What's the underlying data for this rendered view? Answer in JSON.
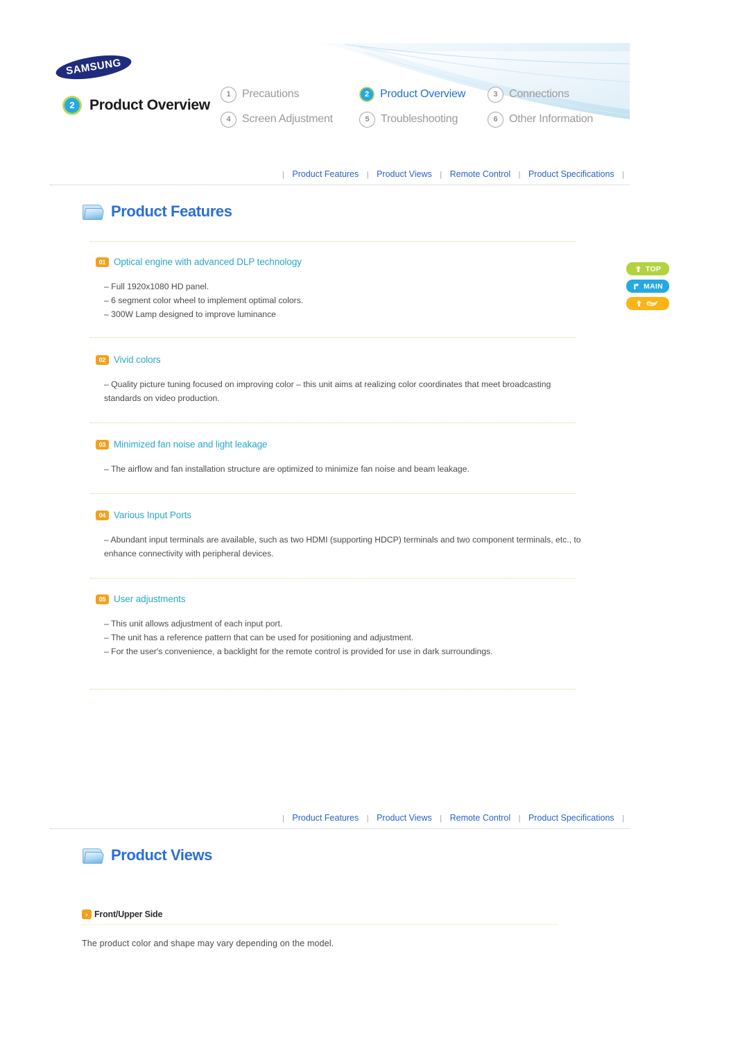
{
  "brand": {
    "logo_text": "SAMSUNG"
  },
  "header": {
    "current_chapter_number": "2",
    "current_chapter_title": "Product Overview",
    "chapters": [
      {
        "num": "1",
        "label": "Precautions",
        "active": false
      },
      {
        "num": "2",
        "label": "Product Overview",
        "active": true
      },
      {
        "num": "3",
        "label": "Connections",
        "active": false
      },
      {
        "num": "4",
        "label": "Screen Adjustment",
        "active": false
      },
      {
        "num": "5",
        "label": "Troubleshooting",
        "active": false
      },
      {
        "num": "6",
        "label": "Other Information",
        "active": false
      }
    ]
  },
  "subnav": {
    "separator": "|",
    "items": [
      "Product Features",
      "Product Views",
      "Remote Control",
      "Product Specifications"
    ]
  },
  "sections": {
    "product_features_title": "Product Features",
    "product_views_title": "Product Views"
  },
  "features": [
    {
      "num": "01",
      "heading": "Optical engine with advanced DLP technology",
      "lines": [
        "– Full 1920x1080 HD panel.",
        "– 6 segment color wheel to implement optimal colors.",
        "– 300W Lamp designed to improve luminance"
      ]
    },
    {
      "num": "02",
      "heading": "Vivid colors",
      "lines": [
        "– Quality picture tuning focused on improving color – this unit aims at realizing color coordinates that meet broadcasting standards on video production."
      ]
    },
    {
      "num": "03",
      "heading": "Minimized fan noise and light leakage",
      "lines": [
        "– The airflow and fan installation structure are optimized to minimize fan noise and beam leakage."
      ]
    },
    {
      "num": "04",
      "heading": "Various Input Ports",
      "lines": [
        "– Abundant input terminals are available, such as two HDMI (supporting HDCP) terminals and two component terminals, etc., to enhance connectivity with peripheral devices."
      ]
    },
    {
      "num": "05",
      "heading": "User adjustments",
      "lines": [
        "– This unit allows adjustment of each input port.",
        "– The unit has a reference pattern that can be used for positioning and adjustment.",
        "– For the user′s convenience, a backlight for the remote control is provided for use in dark surroundings."
      ]
    }
  ],
  "side_buttons": [
    {
      "id": "top",
      "label": "TOP",
      "icon": "up-arrow-icon",
      "color": "#b2d33e"
    },
    {
      "id": "main",
      "label": "MAIN",
      "icon": "branch-arrow-icon",
      "color": "#25a9e0"
    },
    {
      "id": "link",
      "label": "",
      "icon": "link-icon",
      "color": "#fbb415"
    }
  ],
  "product_views": {
    "subsection_arrow": "›",
    "subsection_label": "Front/Upper Side",
    "note": "The product color and shape may vary depending on the model."
  },
  "colors": {
    "link_blue": "#2a62c8",
    "title_blue": "#2a6fd4",
    "heading_teal": "#2aa7c9",
    "badge_orange": "#f2a01e",
    "samsung_navy": "#1f2c7e",
    "green": "#b2d33e",
    "blue": "#25a9e0",
    "amber": "#fbb415"
  }
}
